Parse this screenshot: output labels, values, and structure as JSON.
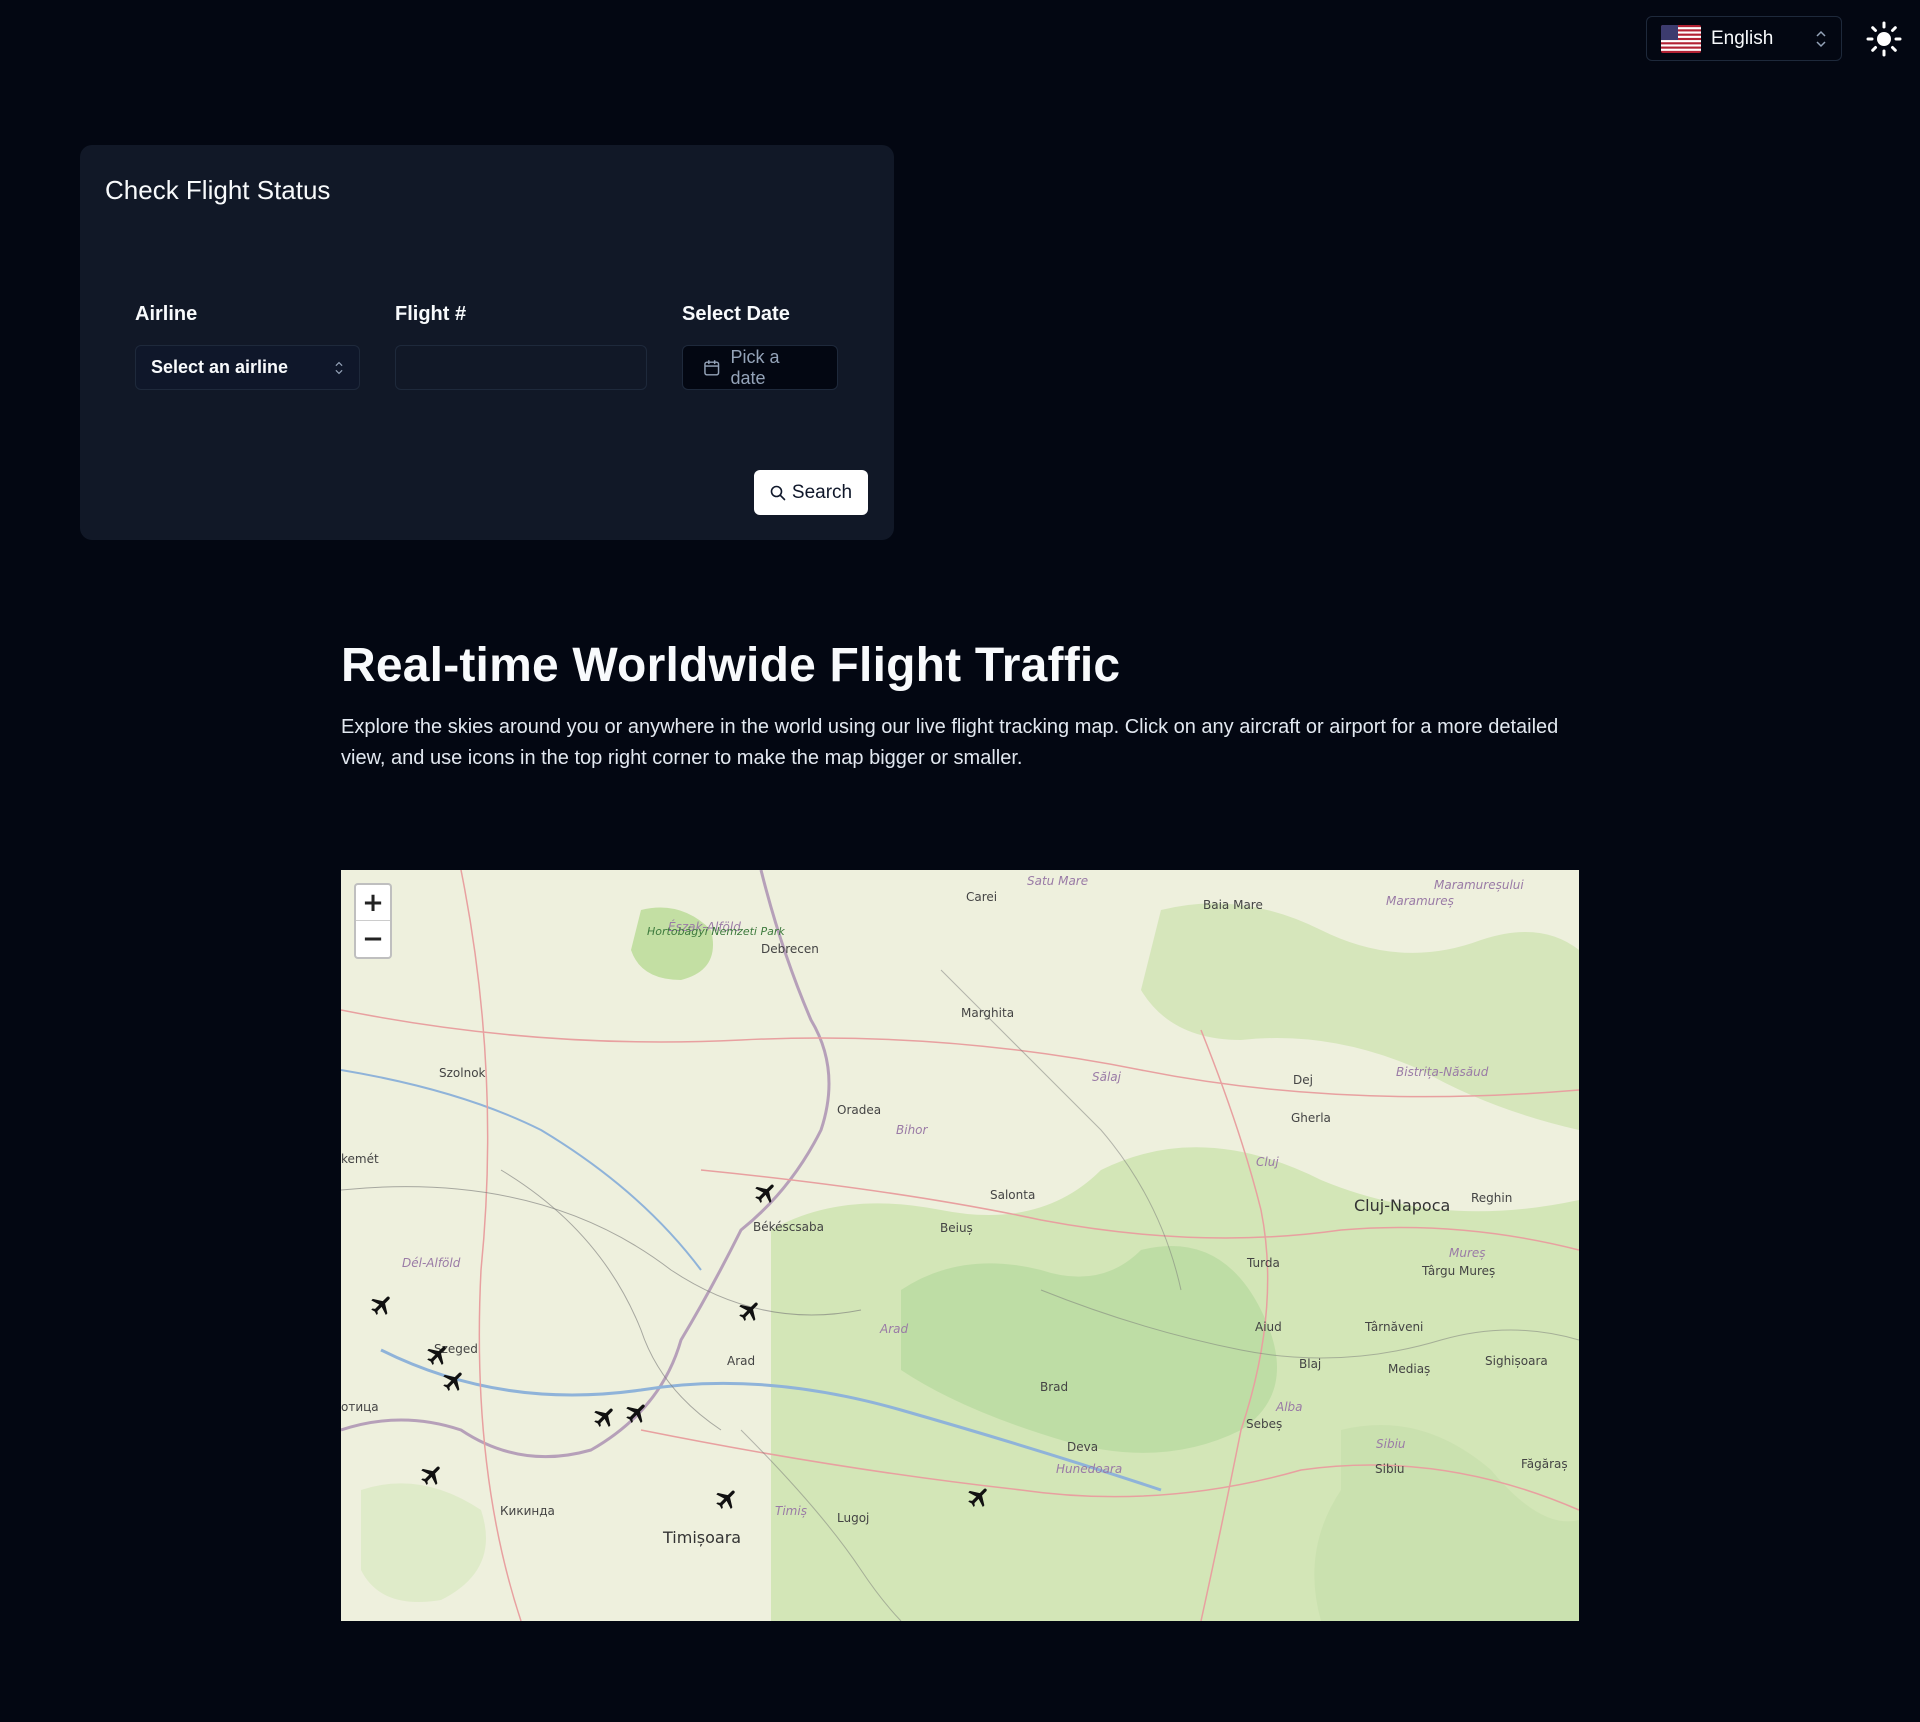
{
  "header": {
    "language": "English",
    "language_flag_icon": "us-flag-icon",
    "theme_icon": "sun-icon"
  },
  "flight_status": {
    "title": "Check Flight Status",
    "airline_label": "Airline",
    "airline_value": "Select an airline",
    "flight_label": "Flight #",
    "flight_value": "",
    "date_label": "Select Date",
    "date_placeholder": "Pick a date",
    "search_label": "Search"
  },
  "hero": {
    "title": "Real-time Worldwide Flight Traffic",
    "description": "Explore the skies around you or anywhere in the world using our live flight tracking map. Click on any aircraft or airport for a more detailed view, and use icons in the top right corner to make the map bigger or smaller."
  },
  "map": {
    "zoom_in": "+",
    "zoom_out": "−",
    "cities": [
      {
        "name": "Satu Mare",
        "cls": "region"
      },
      {
        "name": "Carei",
        "cls": ""
      },
      {
        "name": "Baia Mare",
        "cls": ""
      },
      {
        "name": "Maramureșului",
        "cls": "region"
      },
      {
        "name": "Maramureș",
        "cls": "region"
      },
      {
        "name": "Észak-Alföld",
        "cls": "region"
      },
      {
        "name": "Debrecen",
        "cls": ""
      },
      {
        "name": "Hortobágyi Nemzeti Park",
        "cls": "park"
      },
      {
        "name": "Marghita",
        "cls": ""
      },
      {
        "name": "Szolnok",
        "cls": ""
      },
      {
        "name": "Sălaj",
        "cls": "region"
      },
      {
        "name": "Dej",
        "cls": ""
      },
      {
        "name": "Bistrița-Năsăud",
        "cls": "region"
      },
      {
        "name": "Oradea",
        "cls": ""
      },
      {
        "name": "Bihor",
        "cls": "region"
      },
      {
        "name": "Gherla",
        "cls": ""
      },
      {
        "name": "Cluj",
        "cls": "region"
      },
      {
        "name": "kemét",
        "cls": ""
      },
      {
        "name": "Salonta",
        "cls": ""
      },
      {
        "name": "Cluj-Napoca",
        "cls": "big"
      },
      {
        "name": "Reghin",
        "cls": ""
      },
      {
        "name": "Békéscsaba",
        "cls": ""
      },
      {
        "name": "Beiuș",
        "cls": ""
      },
      {
        "name": "Dél-Alföld",
        "cls": "region"
      },
      {
        "name": "Turda",
        "cls": ""
      },
      {
        "name": "Mureș",
        "cls": "region"
      },
      {
        "name": "Târgu Mureș",
        "cls": ""
      },
      {
        "name": "Arad",
        "cls": "region"
      },
      {
        "name": "Aiud",
        "cls": ""
      },
      {
        "name": "Târnăveni",
        "cls": ""
      },
      {
        "name": "Szeged",
        "cls": ""
      },
      {
        "name": "Arad",
        "cls": ""
      },
      {
        "name": "Blaj",
        "cls": ""
      },
      {
        "name": "Mediaș",
        "cls": ""
      },
      {
        "name": "Sighișoara",
        "cls": ""
      },
      {
        "name": "Brad",
        "cls": ""
      },
      {
        "name": "Alba",
        "cls": "region"
      },
      {
        "name": "Sebeș",
        "cls": ""
      },
      {
        "name": "Sibiu",
        "cls": "region"
      },
      {
        "name": "Deva",
        "cls": ""
      },
      {
        "name": "Кикинда",
        "cls": ""
      },
      {
        "name": "Hunedoara",
        "cls": "region"
      },
      {
        "name": "Sibiu",
        "cls": ""
      },
      {
        "name": "Făgăraș",
        "cls": ""
      },
      {
        "name": "Timișoara",
        "cls": "big"
      },
      {
        "name": "Timiș",
        "cls": "region"
      },
      {
        "name": "Lugoj",
        "cls": ""
      },
      {
        "name": "отица",
        "cls": ""
      }
    ]
  }
}
